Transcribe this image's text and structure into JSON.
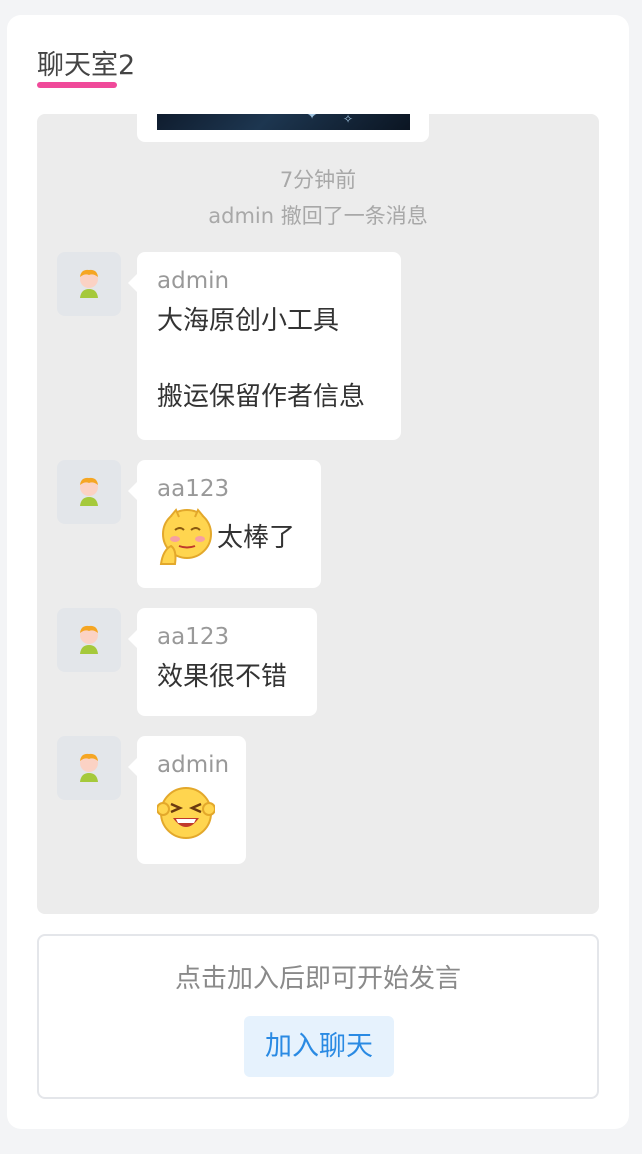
{
  "header": {
    "title": "聊天室2"
  },
  "chat": {
    "system": {
      "time": "7分钟前",
      "recall_notice": "admin 撤回了一条消息"
    },
    "messages": [
      {
        "user": "admin",
        "lines": "大海原创小工具\n\n搬运保留作者信息"
      },
      {
        "user": "aa123",
        "emoji": "shy-face-emoji",
        "text": "太棒了"
      },
      {
        "user": "aa123",
        "text": "效果很不错"
      },
      {
        "user": "admin",
        "emoji": "laughing-face-emoji"
      }
    ]
  },
  "join": {
    "hint": "点击加入后即可开始发言",
    "button_label": "加入聊天"
  },
  "colors": {
    "accent_underline": "#f04a9a",
    "button_text": "#2a8ae3",
    "button_bg": "#e6f2fd"
  }
}
